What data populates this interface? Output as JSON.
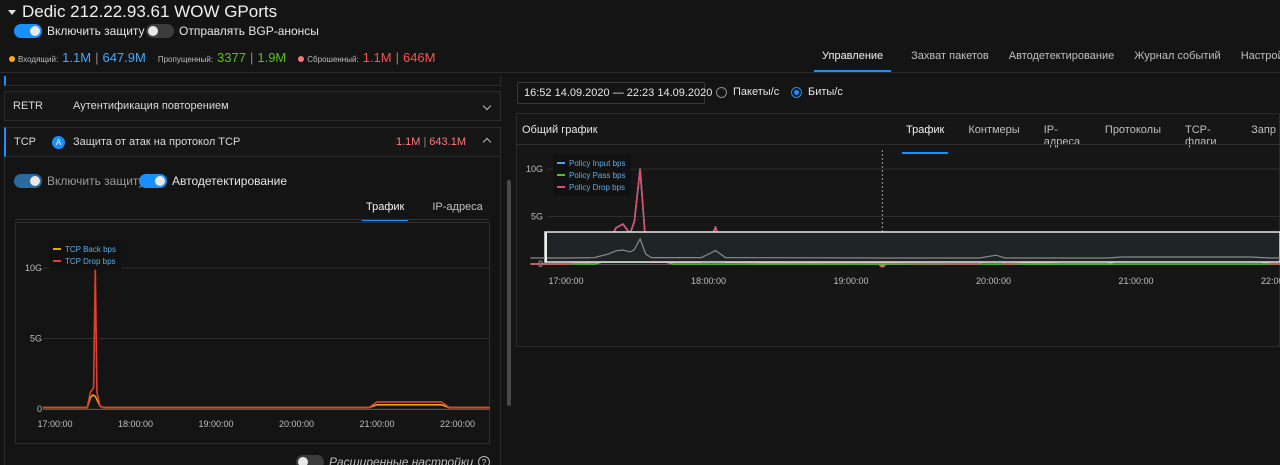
{
  "header": {
    "title": "Dedic 212.22.93.61 WOW GPorts",
    "toggle_protection_label": "Включить защиту",
    "toggle_bgp_label": "Отправлять BGP-анонсы"
  },
  "stats": {
    "incoming_label": "Входящий:",
    "incoming_a": "1.1M",
    "incoming_b": "647.9M",
    "passed_label": "Пропущенный:",
    "passed_a": "3377",
    "passed_b": "1.9M",
    "dropped_label": "Сброшенный:",
    "dropped_a": "1.1M",
    "dropped_b": "646M",
    "sep": "|"
  },
  "top_tabs": [
    "Управление",
    "Захват пакетов",
    "Автодетектирование",
    "Журнал событий",
    "Настройки п"
  ],
  "left": {
    "retr": {
      "code": "RETR",
      "name": "Аутентификация повторением"
    },
    "tcp": {
      "code": "TCP",
      "badge": "A",
      "name": "Защита от атак на протокол TCP",
      "value_a": "1.1M",
      "value_b": "643.1M"
    },
    "toggle_protection_label": "Включить защиту",
    "toggle_autodetect_label": "Автодетектирование",
    "subtabs": [
      "Трафик",
      "IP-адреса"
    ],
    "advanced_label": "Расширенные настройки",
    "help_glyph": "?"
  },
  "right": {
    "time_range": "16:52 14.09.2020 — 22:23 14.09.2020",
    "radio_packets": "Пакеты/с",
    "radio_bits": "Биты/с",
    "chart_title": "Общий график",
    "tabs": [
      "Трафик",
      "Контмеры",
      "IP-адреса",
      "Протоколы",
      "TCP-флаги",
      "Запр"
    ]
  },
  "chart_data": [
    {
      "type": "line",
      "x": [
        "17:00:00",
        "18:00:00",
        "19:00:00",
        "20:00:00",
        "21:00:00",
        "22:00:00"
      ],
      "y_ticks": [
        "0",
        "5G",
        "10G"
      ],
      "ylim": [
        0,
        12.5
      ],
      "series": [
        {
          "name": "TCP Back bps",
          "color": "#e8a317",
          "points": [
            [
              16.85,
              0.1
            ],
            [
              17.4,
              0.1
            ],
            [
              17.44,
              0.8
            ],
            [
              17.47,
              1.0
            ],
            [
              17.5,
              0.9
            ],
            [
              17.56,
              0.2
            ],
            [
              17.6,
              0.1
            ],
            [
              20.9,
              0.1
            ],
            [
              21.0,
              0.3
            ],
            [
              21.8,
              0.3
            ],
            [
              21.9,
              0.1
            ],
            [
              22.4,
              0.1
            ]
          ]
        },
        {
          "name": "TCP Drop bps",
          "color": "#e0402a",
          "points": [
            [
              16.85,
              0.1
            ],
            [
              17.4,
              0.1
            ],
            [
              17.44,
              1.2
            ],
            [
              17.48,
              1.5
            ],
            [
              17.5,
              10
            ],
            [
              17.52,
              1.2
            ],
            [
              17.56,
              0.2
            ],
            [
              17.6,
              0.1
            ],
            [
              20.9,
              0.1
            ],
            [
              21.0,
              0.5
            ],
            [
              21.8,
              0.5
            ],
            [
              21.9,
              0.1
            ],
            [
              22.4,
              0.1
            ]
          ]
        }
      ]
    },
    {
      "type": "line",
      "x": [
        "17:00:00",
        "18:00:00",
        "19:00:00",
        "20:00:00",
        "21:00:00",
        "22:00:00"
      ],
      "y_ticks": [
        "0",
        "5G",
        "10G"
      ],
      "ylim": [
        0,
        12
      ],
      "series": [
        {
          "name": "Policy Input bps",
          "color": "#4fa3e0",
          "points": [
            [
              16.75,
              0
            ],
            [
              17.0,
              0
            ],
            [
              17.2,
              0.2
            ],
            [
              17.3,
              2.2
            ],
            [
              17.35,
              3.8
            ],
            [
              17.4,
              4.2
            ],
            [
              17.45,
              3.2
            ],
            [
              17.48,
              4.5
            ],
            [
              17.52,
              10
            ],
            [
              17.56,
              2
            ],
            [
              17.6,
              0.2
            ],
            [
              17.7,
              0.2
            ],
            [
              17.95,
              0.2
            ],
            [
              18.05,
              3.9
            ],
            [
              18.12,
              0.2
            ],
            [
              19.2,
              0
            ],
            [
              19.9,
              0
            ],
            [
              20.02,
              1.5
            ],
            [
              20.08,
              0
            ],
            [
              20.8,
              0
            ],
            [
              20.9,
              0.5
            ],
            [
              21.8,
              0.5
            ],
            [
              21.95,
              0
            ],
            [
              22.1,
              0
            ]
          ]
        },
        {
          "name": "Policy Pass bps",
          "color": "#52c41a",
          "points": [
            [
              16.75,
              0
            ],
            [
              17.2,
              0
            ],
            [
              17.25,
              0.2
            ],
            [
              17.7,
              0.2
            ],
            [
              17.75,
              0
            ],
            [
              22.1,
              0
            ]
          ]
        },
        {
          "name": "Policy Drop bps",
          "color": "#d9536f",
          "points": [
            [
              16.75,
              0
            ],
            [
              17.0,
              0
            ],
            [
              17.2,
              0.2
            ],
            [
              17.3,
              2.2
            ],
            [
              17.35,
              3.8
            ],
            [
              17.4,
              4.2
            ],
            [
              17.45,
              3.2
            ],
            [
              17.48,
              4.5
            ],
            [
              17.52,
              10
            ],
            [
              17.56,
              2
            ],
            [
              17.6,
              0.2
            ],
            [
              17.95,
              0.2
            ],
            [
              18.05,
              3.9
            ],
            [
              18.12,
              0.2
            ],
            [
              19.9,
              0
            ],
            [
              20.02,
              1.5
            ],
            [
              20.08,
              0
            ],
            [
              20.9,
              0.5
            ],
            [
              21.8,
              0.5
            ],
            [
              21.95,
              0
            ],
            [
              22.1,
              0
            ]
          ]
        }
      ]
    }
  ]
}
